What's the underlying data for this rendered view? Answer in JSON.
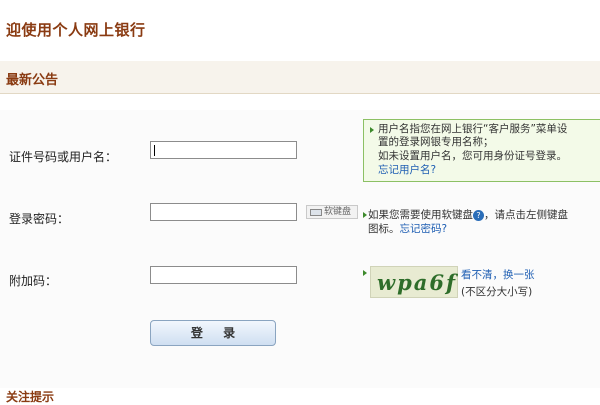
{
  "page": {
    "title": "迎使用个人网上银行"
  },
  "notice": {
    "title": "最新公告"
  },
  "form": {
    "id_label": "证件号码或用户名：",
    "id_value": "",
    "password_label": "登录密码：",
    "password_value": "",
    "extra_code_label": "附加码：",
    "extra_code_value": "",
    "soft_keyboard_label": "软键盘",
    "login_label": "登 录"
  },
  "hint": {
    "line1": "用户名指您在网上银行“客户服务”菜单设",
    "line2": "置的登录网银专用名称；",
    "line3": "如未设置用户名，您可用身份证号登录。",
    "forgot_username": "忘记用户名?"
  },
  "password_hint": {
    "line1_prefix": "如果您需要使用软键盘",
    "line1_suffix": "，请点击左侧键盘",
    "line2_prefix": "图标。",
    "forgot_password": "忘记密码?"
  },
  "captcha": {
    "text": "wpa6f",
    "refresh_prefix": "看不清，",
    "refresh_link": "换一张",
    "case_note": "(不区分大小写)"
  },
  "bottom": {
    "title": "关注提示"
  }
}
